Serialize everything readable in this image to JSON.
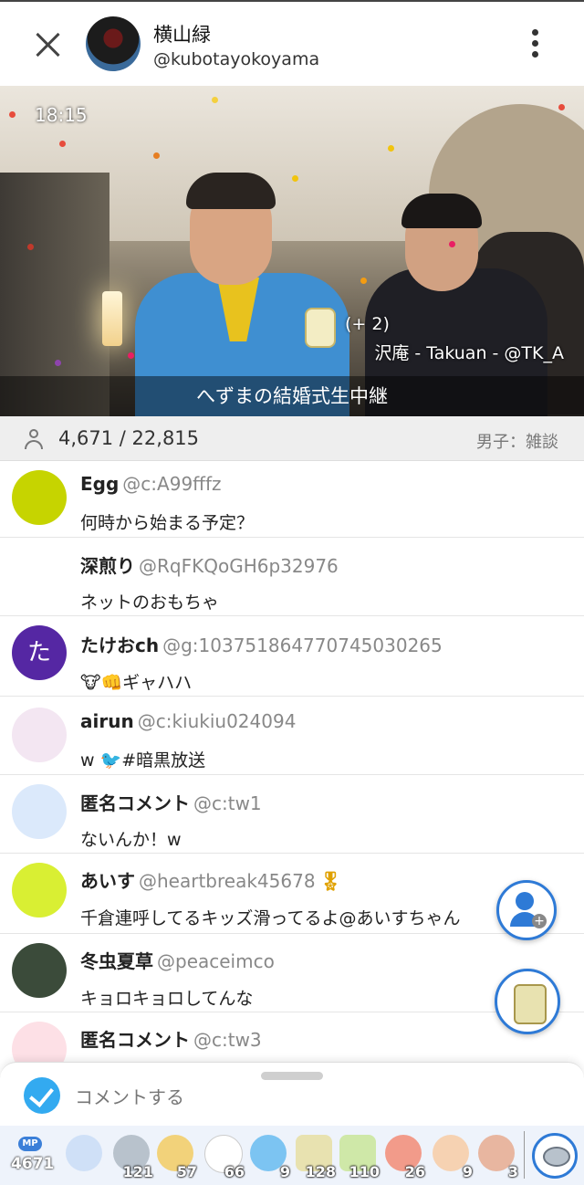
{
  "header": {
    "name": "横山緑",
    "handle": "@kubotayokoyama"
  },
  "video": {
    "time": "18:15",
    "gift_count": "(+ 2)",
    "gift_sender": "沢庵 - Takuan - @TK_A",
    "caption": "へずまの結婚式生中継"
  },
  "stats": {
    "viewers": "4,671 / 22,815",
    "category": "男子：雑談"
  },
  "comments": [
    {
      "name": "Egg",
      "id": "@c:A99fffz",
      "text": "何時から始まる予定？",
      "avatar_color": "#c6d400"
    },
    {
      "name": "深煎り",
      "id": "@RqFKQoGH6p32976",
      "text": "ネットのおもちゃ",
      "avatar_color": ""
    },
    {
      "name": "たけおch",
      "id": "@g:1037518647707450302​65",
      "text": "🐮👊ギャハハ",
      "avatar_color": "#5527a3",
      "avatar_letter": "た"
    },
    {
      "name": "airun",
      "id": "@c:kiukiu024094",
      "text": "w 🐦#暗黒放送",
      "avatar_color": "#f3e6f2"
    },
    {
      "name": "匿名コメント",
      "id": "@c:tw1",
      "text": "ないんか！w",
      "avatar_color": "#dbe9fb"
    },
    {
      "name": "あいす",
      "id": "@heartbreak45678",
      "text": "千倉連呼してるキッズ滑ってるよ@あいすちゃん",
      "avatar_color": "#d9ef33"
    },
    {
      "name": "冬虫夏草",
      "id": "@peaceimco",
      "text": "キョロキョロしてんな",
      "avatar_color": "#3b4b3a"
    },
    {
      "name": "匿名コメント",
      "id": "@c:tw3",
      "text": "",
      "avatar_color": "#fde0e6"
    }
  ],
  "composer": {
    "placeholder": "コメントする"
  },
  "giftbar": {
    "mp_label": "MP",
    "mp_value": "4671",
    "gifts": [
      {
        "icon": "smile-gift-icon",
        "count": "",
        "color": "#cfe0f7"
      },
      {
        "icon": "coin-gift-icon",
        "count": "121",
        "color": "#b8c2cc"
      },
      {
        "icon": "pompom-gift-icon",
        "count": "57",
        "color": "#f2d27a"
      },
      {
        "icon": "snowman-gift-icon",
        "count": "66",
        "color": "#ffffff"
      },
      {
        "icon": "fireworks-gift-icon",
        "count": "9",
        "color": "#7cc4f2"
      },
      {
        "icon": "tea-gift-icon",
        "count": "128",
        "color": "#e8e2b0"
      },
      {
        "icon": "tea10-gift-icon",
        "count": "110",
        "color": "#cfe8a8"
      },
      {
        "icon": "sushi-gift-icon",
        "count": "26",
        "color": "#f29b8a"
      },
      {
        "icon": "clap-gift-icon",
        "count": "9",
        "color": "#f6d2b2"
      },
      {
        "icon": "cake-gift-icon",
        "count": "3",
        "color": "#e8b6a0"
      }
    ]
  }
}
